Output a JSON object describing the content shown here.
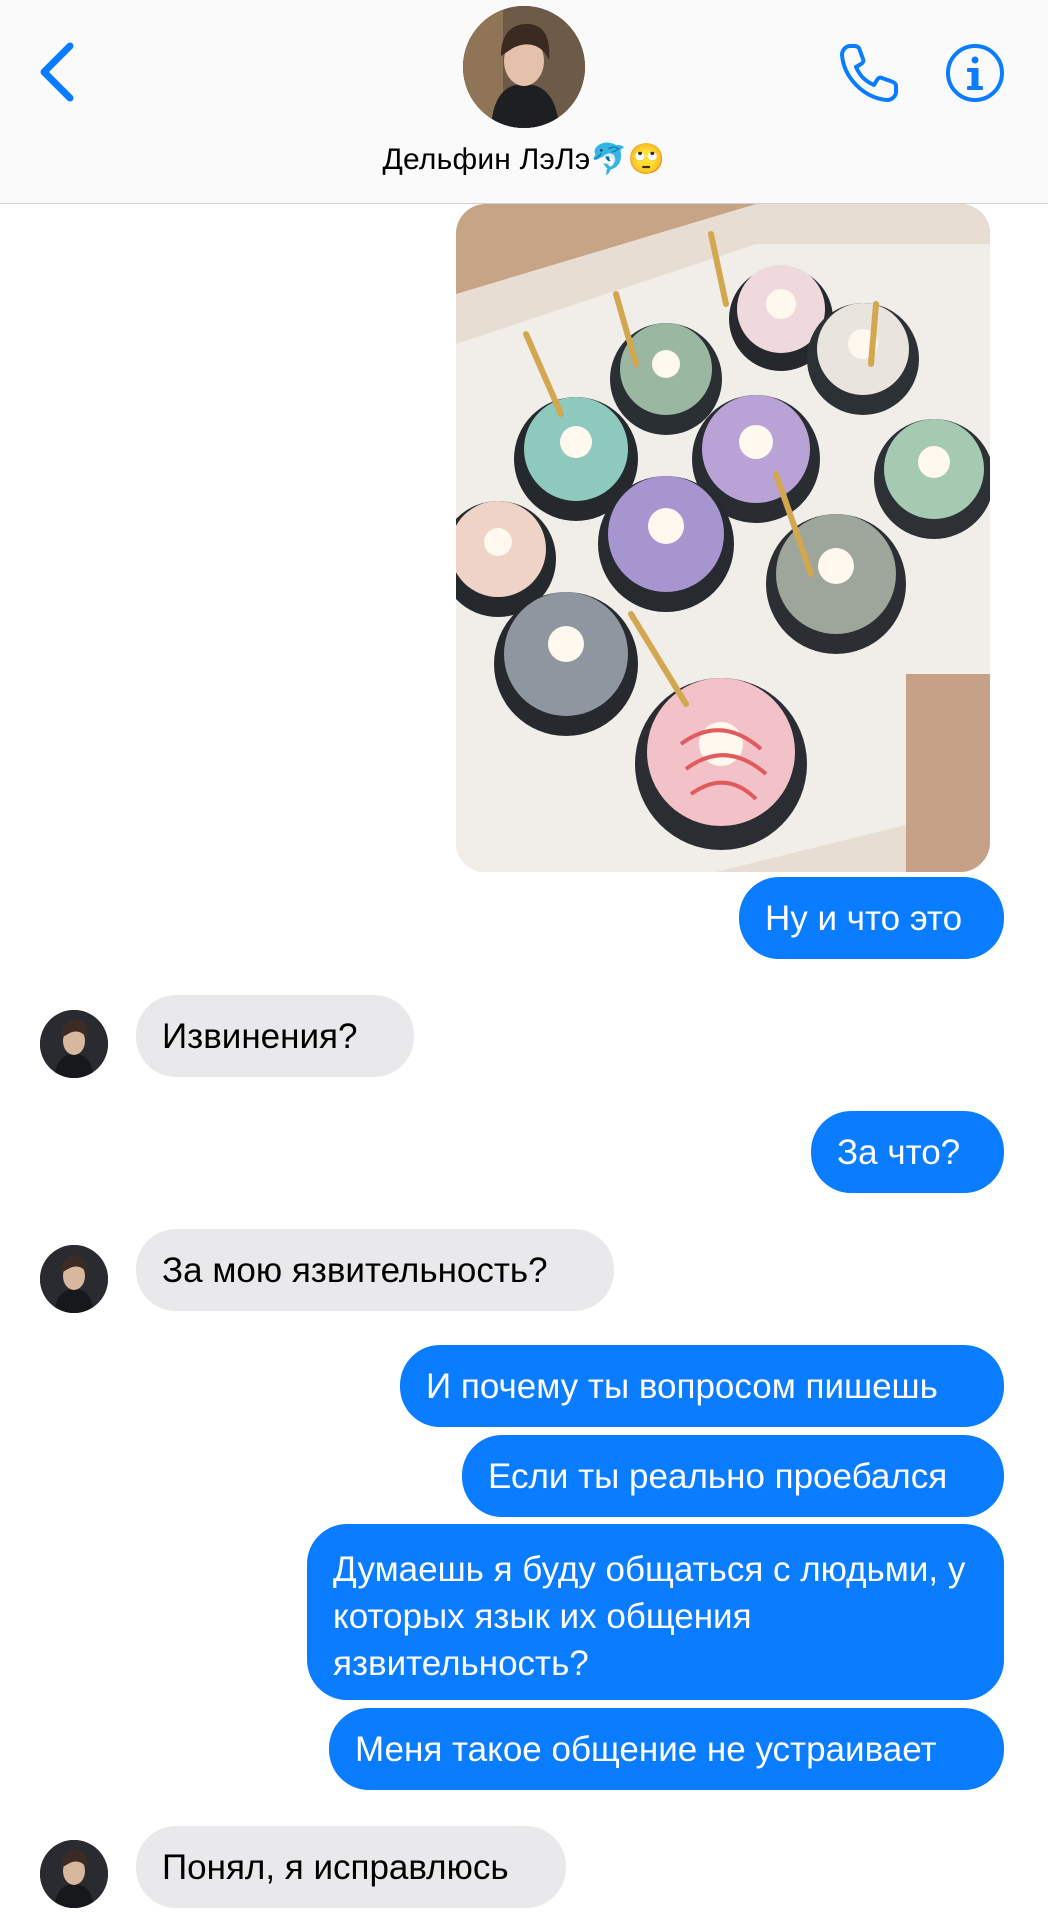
{
  "header": {
    "contact_name": "Дельфин ЛэЛэ🐬🙄",
    "icons": [
      "back-chevron-icon",
      "phone-icon",
      "info-icon"
    ],
    "accent_color": "#0a7cff"
  },
  "messages": [
    {
      "direction": "outgoing",
      "text": "Ну и что это"
    },
    {
      "direction": "incoming",
      "text": "Извинения?"
    },
    {
      "direction": "outgoing",
      "text": "За что?"
    },
    {
      "direction": "incoming",
      "text": "За мою язвительность?"
    },
    {
      "direction": "outgoing",
      "text": "И почему ты вопросом пишешь"
    },
    {
      "direction": "outgoing",
      "text": "Если ты реально проебался"
    },
    {
      "direction": "outgoing",
      "text": "Думаешь я буду общаться с людьми, у которых язык их общения язвительность?"
    },
    {
      "direction": "outgoing",
      "text": "Меня такое общение не устраивает"
    },
    {
      "direction": "incoming",
      "text": "Понял, я исправлюсь"
    }
  ],
  "colors": {
    "outgoing_bubble": "#0a7cff",
    "incoming_bubble": "#e9e9eb"
  }
}
